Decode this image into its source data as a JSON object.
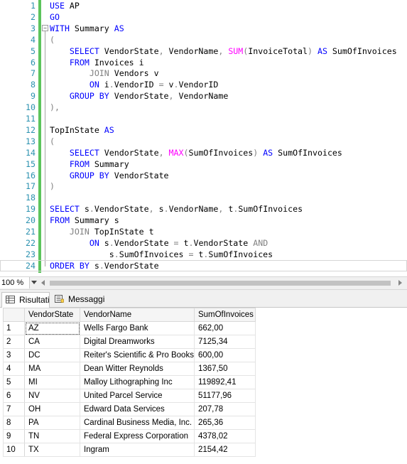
{
  "editor": {
    "lines": [
      {
        "n": "1",
        "tokens": [
          {
            "t": "USE",
            "c": "kw"
          },
          {
            "t": " AP",
            "c": "tx"
          }
        ]
      },
      {
        "n": "2",
        "tokens": [
          {
            "t": "GO",
            "c": "kw"
          }
        ]
      },
      {
        "n": "3",
        "fold": "−",
        "tokens": [
          {
            "t": "WITH",
            "c": "kw"
          },
          {
            "t": " Summary ",
            "c": "tx"
          },
          {
            "t": "AS",
            "c": "kw"
          }
        ]
      },
      {
        "n": "4",
        "tokens": [
          {
            "t": "(",
            "c": "gr"
          }
        ]
      },
      {
        "n": "5",
        "tokens": [
          {
            "t": "    ",
            "c": "tx"
          },
          {
            "t": "SELECT",
            "c": "kw"
          },
          {
            "t": " VendorState",
            "c": "tx"
          },
          {
            "t": ",",
            "c": "gr"
          },
          {
            "t": " VendorName",
            "c": "tx"
          },
          {
            "t": ",",
            "c": "gr"
          },
          {
            "t": " ",
            "c": "tx"
          },
          {
            "t": "SUM",
            "c": "fn"
          },
          {
            "t": "(",
            "c": "gr"
          },
          {
            "t": "InvoiceTotal",
            "c": "tx"
          },
          {
            "t": ")",
            "c": "gr"
          },
          {
            "t": " ",
            "c": "tx"
          },
          {
            "t": "AS",
            "c": "kw"
          },
          {
            "t": " SumOfInvoices",
            "c": "tx"
          }
        ]
      },
      {
        "n": "6",
        "tokens": [
          {
            "t": "    ",
            "c": "tx"
          },
          {
            "t": "FROM",
            "c": "kw"
          },
          {
            "t": " Invoices i",
            "c": "tx"
          }
        ]
      },
      {
        "n": "7",
        "tokens": [
          {
            "t": "        ",
            "c": "tx"
          },
          {
            "t": "JOIN",
            "c": "gr"
          },
          {
            "t": " Vendors v",
            "c": "tx"
          }
        ]
      },
      {
        "n": "8",
        "tokens": [
          {
            "t": "        ",
            "c": "tx"
          },
          {
            "t": "ON",
            "c": "kw"
          },
          {
            "t": " i",
            "c": "tx"
          },
          {
            "t": ".",
            "c": "gr"
          },
          {
            "t": "VendorID ",
            "c": "tx"
          },
          {
            "t": "=",
            "c": "gr"
          },
          {
            "t": " v",
            "c": "tx"
          },
          {
            "t": ".",
            "c": "gr"
          },
          {
            "t": "VendorID",
            "c": "tx"
          }
        ]
      },
      {
        "n": "9",
        "tokens": [
          {
            "t": "    ",
            "c": "tx"
          },
          {
            "t": "GROUP BY",
            "c": "kw"
          },
          {
            "t": " VendorState",
            "c": "tx"
          },
          {
            "t": ",",
            "c": "gr"
          },
          {
            "t": " VendorName",
            "c": "tx"
          }
        ]
      },
      {
        "n": "10",
        "tokens": [
          {
            "t": "),",
            "c": "gr"
          }
        ]
      },
      {
        "n": "11",
        "tokens": []
      },
      {
        "n": "12",
        "tokens": [
          {
            "t": "TopInState ",
            "c": "tx"
          },
          {
            "t": "AS",
            "c": "kw"
          }
        ]
      },
      {
        "n": "13",
        "tokens": [
          {
            "t": "(",
            "c": "gr"
          }
        ]
      },
      {
        "n": "14",
        "tokens": [
          {
            "t": "    ",
            "c": "tx"
          },
          {
            "t": "SELECT",
            "c": "kw"
          },
          {
            "t": " VendorState",
            "c": "tx"
          },
          {
            "t": ",",
            "c": "gr"
          },
          {
            "t": " ",
            "c": "tx"
          },
          {
            "t": "MAX",
            "c": "fn"
          },
          {
            "t": "(",
            "c": "gr"
          },
          {
            "t": "SumOfInvoices",
            "c": "tx"
          },
          {
            "t": ")",
            "c": "gr"
          },
          {
            "t": " ",
            "c": "tx"
          },
          {
            "t": "AS",
            "c": "kw"
          },
          {
            "t": " SumOfInvoices",
            "c": "tx"
          }
        ]
      },
      {
        "n": "15",
        "tokens": [
          {
            "t": "    ",
            "c": "tx"
          },
          {
            "t": "FROM",
            "c": "kw"
          },
          {
            "t": " Summary",
            "c": "tx"
          }
        ]
      },
      {
        "n": "16",
        "tokens": [
          {
            "t": "    ",
            "c": "tx"
          },
          {
            "t": "GROUP BY",
            "c": "kw"
          },
          {
            "t": " VendorState",
            "c": "tx"
          }
        ]
      },
      {
        "n": "17",
        "tokens": [
          {
            "t": ")",
            "c": "gr"
          }
        ]
      },
      {
        "n": "18",
        "tokens": []
      },
      {
        "n": "19",
        "tokens": [
          {
            "t": "SELECT",
            "c": "kw"
          },
          {
            "t": " s",
            "c": "tx"
          },
          {
            "t": ".",
            "c": "gr"
          },
          {
            "t": "VendorState",
            "c": "tx"
          },
          {
            "t": ",",
            "c": "gr"
          },
          {
            "t": " s",
            "c": "tx"
          },
          {
            "t": ".",
            "c": "gr"
          },
          {
            "t": "VendorName",
            "c": "tx"
          },
          {
            "t": ",",
            "c": "gr"
          },
          {
            "t": " t",
            "c": "tx"
          },
          {
            "t": ".",
            "c": "gr"
          },
          {
            "t": "SumOfInvoices",
            "c": "tx"
          }
        ]
      },
      {
        "n": "20",
        "tokens": [
          {
            "t": "FROM",
            "c": "kw"
          },
          {
            "t": " Summary s",
            "c": "tx"
          }
        ]
      },
      {
        "n": "21",
        "tokens": [
          {
            "t": "    ",
            "c": "tx"
          },
          {
            "t": "JOIN",
            "c": "gr"
          },
          {
            "t": " TopInState t",
            "c": "tx"
          }
        ]
      },
      {
        "n": "22",
        "tokens": [
          {
            "t": "        ",
            "c": "tx"
          },
          {
            "t": "ON",
            "c": "kw"
          },
          {
            "t": " s",
            "c": "tx"
          },
          {
            "t": ".",
            "c": "gr"
          },
          {
            "t": "VendorState ",
            "c": "tx"
          },
          {
            "t": "=",
            "c": "gr"
          },
          {
            "t": " t",
            "c": "tx"
          },
          {
            "t": ".",
            "c": "gr"
          },
          {
            "t": "VendorState ",
            "c": "tx"
          },
          {
            "t": "AND",
            "c": "gr"
          }
        ]
      },
      {
        "n": "23",
        "tokens": [
          {
            "t": "            s",
            "c": "tx"
          },
          {
            "t": ".",
            "c": "gr"
          },
          {
            "t": "SumOfInvoices ",
            "c": "tx"
          },
          {
            "t": "=",
            "c": "gr"
          },
          {
            "t": " t",
            "c": "tx"
          },
          {
            "t": ".",
            "c": "gr"
          },
          {
            "t": "SumOfInvoices",
            "c": "tx"
          }
        ]
      },
      {
        "n": "24",
        "current": true,
        "tokens": [
          {
            "t": "ORDER BY",
            "c": "kw"
          },
          {
            "t": " s",
            "c": "tx"
          },
          {
            "t": ".",
            "c": "gr"
          },
          {
            "t": "VendorState",
            "c": "tx"
          }
        ]
      }
    ]
  },
  "zoom": {
    "value": "100 %"
  },
  "tabs": {
    "results_label": "Risultati",
    "messages_label": "Messaggi"
  },
  "grid": {
    "columns": [
      "VendorState",
      "VendorName",
      "SumOfInvoices"
    ],
    "rows": [
      [
        "1",
        "AZ",
        "Wells Fargo Bank",
        "662,00"
      ],
      [
        "2",
        "CA",
        "Digital Dreamworks",
        "7125,34"
      ],
      [
        "3",
        "DC",
        "Reiter's Scientific & Pro Books",
        "600,00"
      ],
      [
        "4",
        "MA",
        "Dean Witter Reynolds",
        "1367,50"
      ],
      [
        "5",
        "MI",
        "Malloy Lithographing Inc",
        "119892,41"
      ],
      [
        "6",
        "NV",
        "United Parcel Service",
        "51177,96"
      ],
      [
        "7",
        "OH",
        "Edward Data Services",
        "207,78"
      ],
      [
        "8",
        "PA",
        "Cardinal Business Media, Inc.",
        "265,36"
      ],
      [
        "9",
        "TN",
        "Federal Express Corporation",
        "4378,02"
      ],
      [
        "10",
        "TX",
        "Ingram",
        "2154,42"
      ]
    ]
  }
}
